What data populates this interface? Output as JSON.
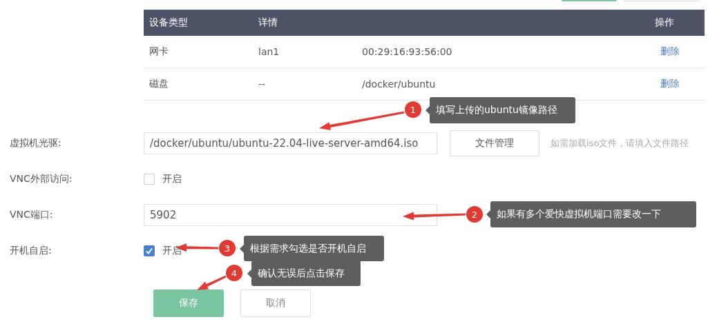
{
  "top_buttons": [
    {
      "kind": "primary"
    },
    {
      "kind": "default"
    }
  ],
  "device_table": {
    "columns": [
      "设备类型",
      "详情",
      "操作"
    ],
    "rows": [
      {
        "type": "网卡",
        "detail": "lan1",
        "value": "00:29:16:93:56:00",
        "action": "删除"
      },
      {
        "type": "磁盘",
        "detail": "--",
        "value": "/docker/ubuntu",
        "action": "删除"
      }
    ]
  },
  "form": [
    {
      "kind": "text",
      "label": "虚拟机光驱:",
      "value": "/docker/ubuntu/ubuntu-22.04-live-server-amd64.iso",
      "button": "文件管理",
      "hint": "如需加载iso文件，请填入文件路径"
    },
    {
      "kind": "checkbox",
      "label": "VNC外部访问:",
      "option": "开启",
      "checked": false
    },
    {
      "kind": "text",
      "label": "VNC端口:",
      "value": "5902"
    },
    {
      "kind": "checkbox",
      "label": "开机自启:",
      "option": "开启",
      "checked": true
    }
  ],
  "buttons": [
    {
      "label": "保存",
      "kind": "primary"
    },
    {
      "label": "取消",
      "kind": "default"
    }
  ],
  "annotations": [
    {
      "number": "1",
      "text": "填写上传的ubuntu镜像路径"
    },
    {
      "number": "2",
      "text": "如果有多个爱快虚拟机端口需要改一下"
    },
    {
      "number": "3",
      "text": "根据需求勾选是否开机自启"
    },
    {
      "number": "4",
      "text": "确认无误后点击保存"
    }
  ]
}
